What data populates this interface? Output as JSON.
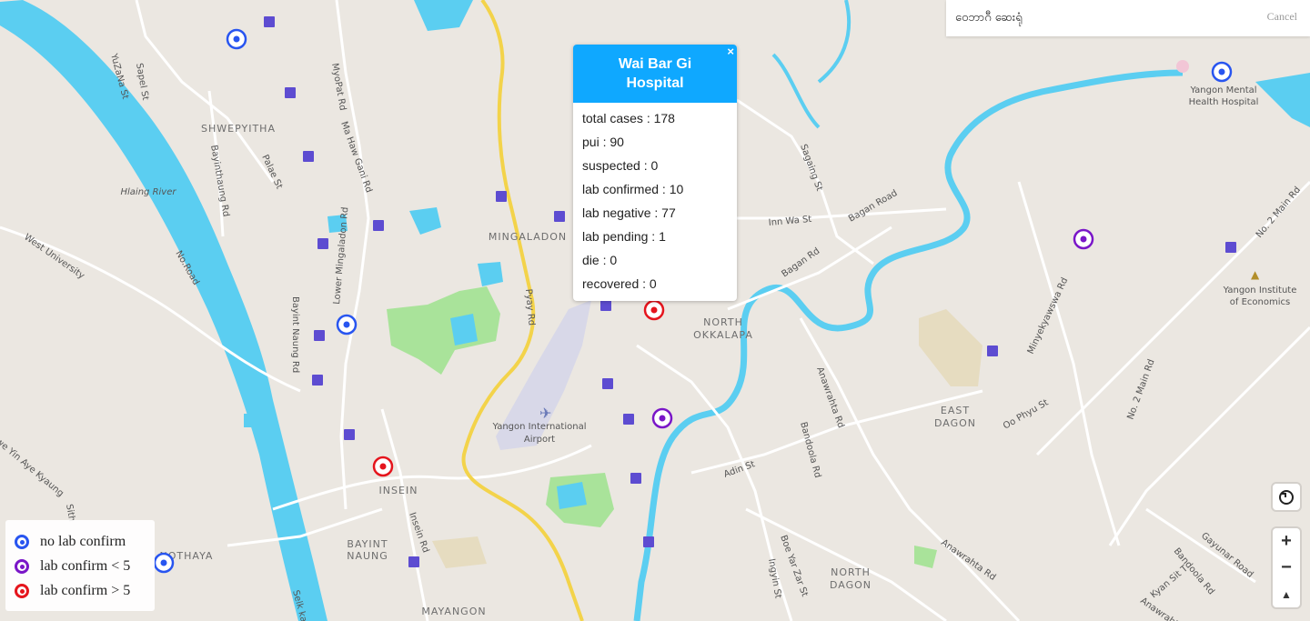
{
  "search": {
    "placeholder": "ဝေဘာဂီ ဆေးရုံ",
    "cancel_label": "Cancel"
  },
  "popup": {
    "title": "Wai Bar Gi Hospital",
    "close_glyph": "×",
    "stats": [
      "total cases : 178",
      "pui : 90",
      "suspected : 0",
      "lab confirmed : 10",
      "lab negative : 77",
      "lab pending : 1",
      "die : 0",
      "recovered : 0"
    ]
  },
  "legend": {
    "items": [
      {
        "label": "no lab confirm",
        "color": "#2855f0"
      },
      {
        "label": "lab confirm < 5",
        "color": "#7a16c8"
      },
      {
        "label": "lab confirm > 5",
        "color": "#e5151d"
      }
    ]
  },
  "controls": {
    "reset_icon": "reset-rotation-icon",
    "zoom_in": "+",
    "zoom_out": "−",
    "compass": "▲"
  },
  "map": {
    "colors": {
      "land": "#ebe7e1",
      "water": "#5bcef1",
      "park": "#a9e39a",
      "major_road": "#f3d34a",
      "road": "#ffffff",
      "transit": "#5d4cd1"
    },
    "area_labels": [
      "SHWEPYITHA",
      "MINGALADON",
      "NORTH OKKALAPA",
      "INSEIN",
      "BAYINT NAUNG",
      "EAST DAGON",
      "NORTH DAGON",
      "MAYANGON",
      "NOTHAYA"
    ],
    "poi_labels": [
      "Yangon Mental Health Hospital",
      "Yangon Institute of Economics",
      "Yangon International Airport"
    ],
    "water_labels": [
      "Hlaing River"
    ],
    "street_labels": [
      "YuZaNa St",
      "Sapel St",
      "MyoPat Rd",
      "Ma Haw Gani Rd",
      "Bayinthaung Rd",
      "Palae St",
      "West University",
      "No.Road",
      "Bayint Naung Rd",
      "Lower Mingaladon Rd",
      "Pyay Rd",
      "Sagaing St",
      "Bagan Road",
      "Inn Wa St",
      "Bagan Rd",
      "No. 2 Main Rd",
      "Minyekyawswa Rd",
      "Oo Phyu St",
      "No. 2 Main Rd",
      "Anawrahta Rd",
      "Bandoola Rd",
      "Adin St",
      "Boe Yar Zar St",
      "Ingyin St",
      "Anawrahta Rd",
      "Bandoola Rd",
      "Gayunar Road",
      "Kyan Sit T",
      "Anawrahta",
      "Insein Rd",
      "Selk kan",
      "hwe Yin Aye Kyaung",
      "Sith"
    ],
    "markers": [
      {
        "name": "blue-marker",
        "status": "no lab confirm"
      },
      {
        "name": "blue-marker",
        "status": "no lab confirm"
      },
      {
        "name": "blue-marker",
        "status": "no lab confirm"
      },
      {
        "name": "blue-marker",
        "status": "no lab confirm"
      },
      {
        "name": "purple-marker",
        "status": "lab confirm < 5"
      },
      {
        "name": "purple-marker",
        "status": "lab confirm < 5"
      },
      {
        "name": "red-marker",
        "status": "lab confirm > 5"
      },
      {
        "name": "red-marker",
        "status": "lab confirm > 5"
      }
    ]
  }
}
